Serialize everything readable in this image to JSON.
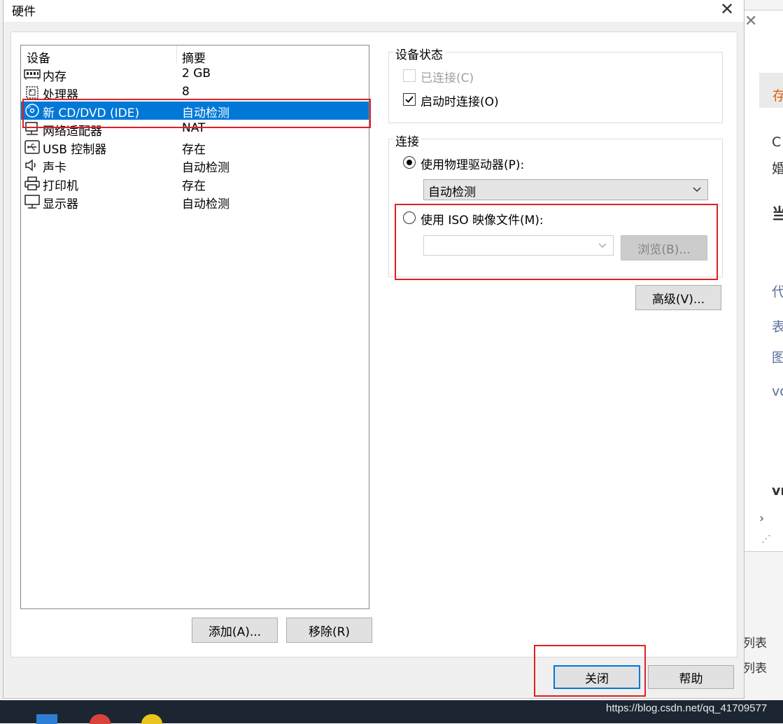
{
  "window": {
    "title": "硬件"
  },
  "device_list": {
    "headers": [
      "设备",
      "摘要"
    ],
    "rows": [
      {
        "name": "内存",
        "summary": "2 GB",
        "icon": "memory-icon"
      },
      {
        "name": "处理器",
        "summary": "8",
        "icon": "processor-icon"
      },
      {
        "name": "新 CD/DVD (IDE)",
        "summary": "自动检测",
        "icon": "cd-dvd-icon",
        "selected": true
      },
      {
        "name": "网络适配器",
        "summary": "NAT",
        "icon": "network-adapter-icon"
      },
      {
        "name": "USB 控制器",
        "summary": "存在",
        "icon": "usb-icon"
      },
      {
        "name": "声卡",
        "summary": "自动检测",
        "icon": "speaker-icon"
      },
      {
        "name": "打印机",
        "summary": "存在",
        "icon": "printer-icon"
      },
      {
        "name": "显示器",
        "summary": "自动检测",
        "icon": "monitor-icon"
      }
    ]
  },
  "list_buttons": {
    "add": "添加(A)...",
    "remove": "移除(R)"
  },
  "device_status": {
    "title": "设备状态",
    "connected": {
      "label": "已连接(C)",
      "checked": false,
      "disabled": true
    },
    "connect_at_power_on": {
      "label": "启动时连接(O)",
      "checked": true
    }
  },
  "connection": {
    "title": "连接",
    "use_physical_drive": {
      "label": "使用物理驱动器(P):",
      "selected": true
    },
    "physical_drive_value": "自动检测",
    "use_iso": {
      "label": "使用 ISO 映像文件(M):",
      "selected": false
    },
    "iso_path_value": "",
    "browse": "浏览(B)..."
  },
  "advanced": "高级(V)...",
  "footer": {
    "close": "关闭",
    "help": "帮助"
  },
  "background": {
    "chars": [
      "存",
      "C",
      "婚",
      "当",
      "代",
      "表",
      "图",
      "vc",
      "vr"
    ],
    "list_text": [
      "列表",
      "列表"
    ]
  },
  "watermark": "https://blog.csdn.net/qq_41709577",
  "colors": {
    "selection": "#0078d7",
    "highlight_box": "#e02020"
  }
}
